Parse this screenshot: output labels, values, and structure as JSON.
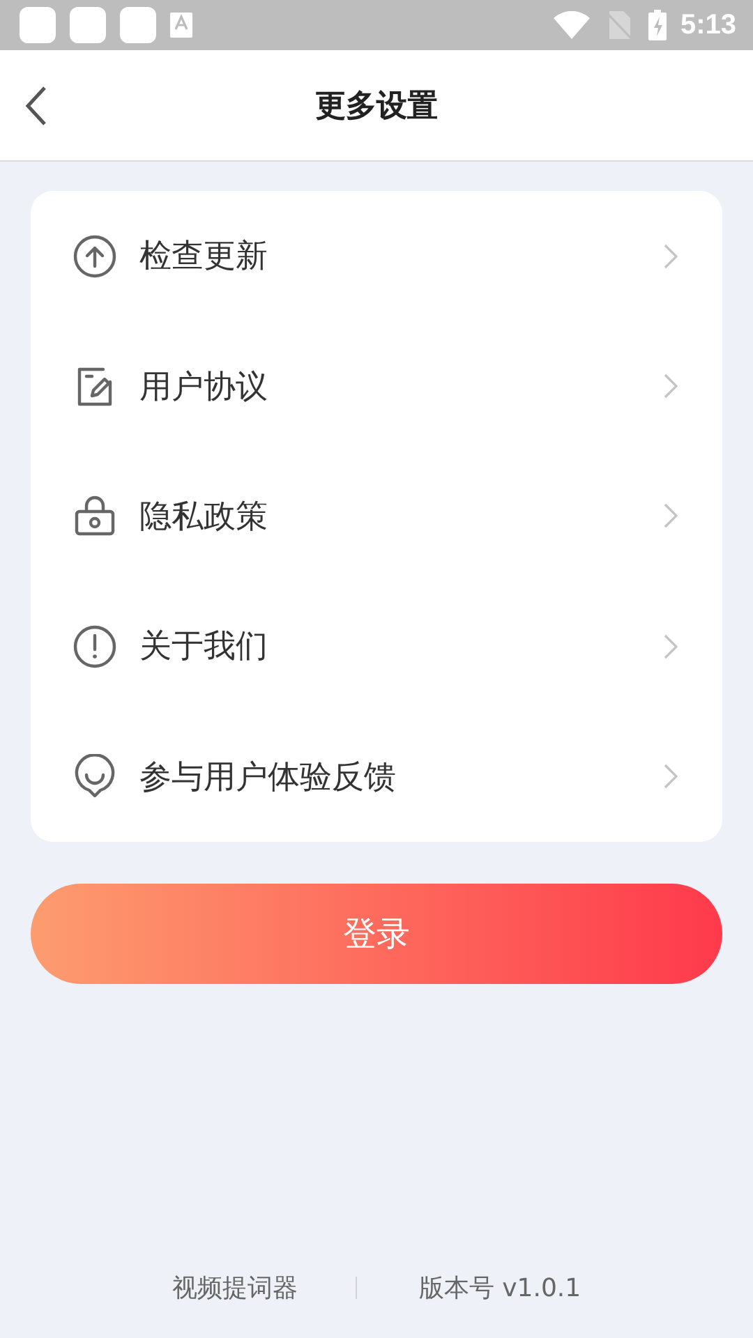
{
  "status_bar": {
    "time": "5:13"
  },
  "header": {
    "title": "更多设置"
  },
  "menu": [
    {
      "kind": "update",
      "label": "检查更新"
    },
    {
      "kind": "agreement",
      "label": "用户协议"
    },
    {
      "kind": "privacy",
      "label": "隐私政策"
    },
    {
      "kind": "about",
      "label": "关于我们"
    },
    {
      "kind": "feedback",
      "label": "参与用户体验反馈"
    }
  ],
  "login_button": {
    "label": "登录"
  },
  "footer": {
    "app_name": "视频提词器",
    "version": "版本号 v1.0.1"
  }
}
